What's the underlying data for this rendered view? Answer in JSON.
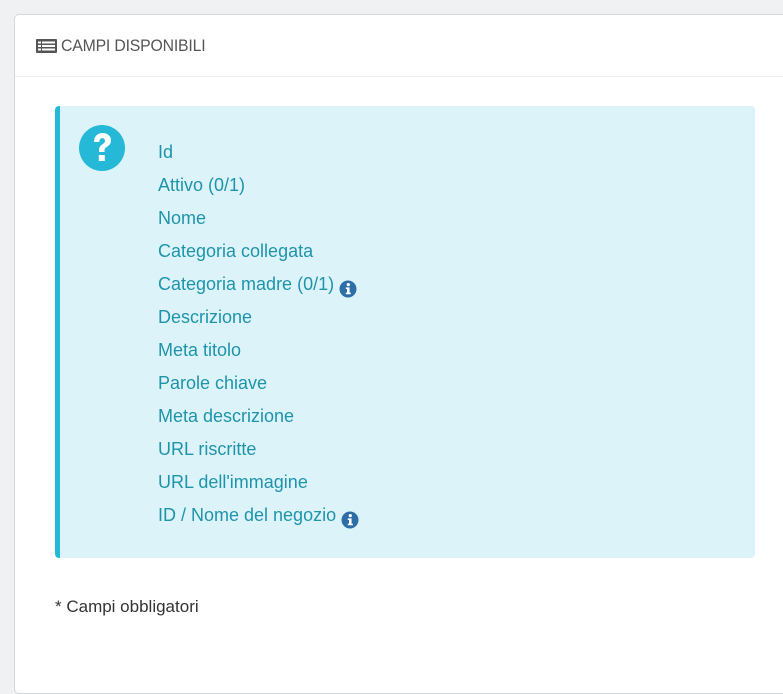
{
  "panel": {
    "title": "CAMPI DISPONIBILI",
    "title_icon": "list-alt-icon"
  },
  "info_box": {
    "icon": "question-circle-icon",
    "fields": [
      {
        "label": "Id",
        "has_info": false
      },
      {
        "label": "Attivo (0/1)",
        "has_info": false
      },
      {
        "label": "Nome",
        "has_info": false
      },
      {
        "label": "Categoria collegata",
        "has_info": false
      },
      {
        "label": "Categoria madre (0/1)",
        "has_info": true
      },
      {
        "label": "Descrizione",
        "has_info": false
      },
      {
        "label": "Meta titolo",
        "has_info": false
      },
      {
        "label": "Parole chiave",
        "has_info": false
      },
      {
        "label": "Meta descrizione",
        "has_info": false
      },
      {
        "label": "URL riscritte",
        "has_info": false
      },
      {
        "label": "URL dell'immagine",
        "has_info": false
      },
      {
        "label": "ID / Nome del negozio",
        "has_info": true
      }
    ]
  },
  "footnote": "* Campi obbligatori",
  "colors": {
    "accent": "#25b9d7",
    "field_text": "#1e94ab",
    "info_box_bg": "#dcf4f9",
    "info_icon": "#2e6ea8"
  }
}
